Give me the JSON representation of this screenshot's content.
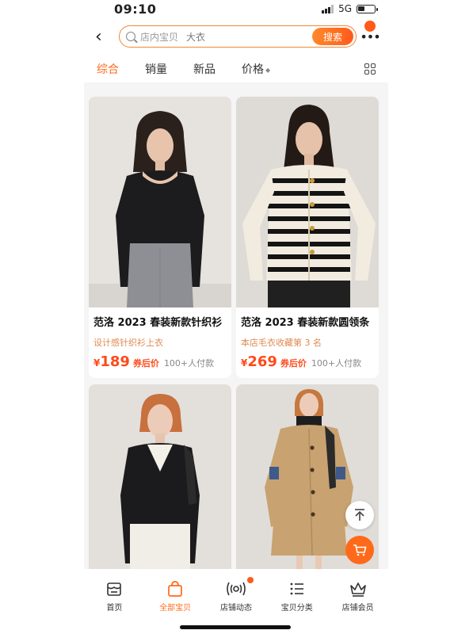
{
  "status": {
    "time": "09:10",
    "network": "5G"
  },
  "search": {
    "placeholder": "店内宝贝",
    "keyword": "大衣",
    "button": "搜索"
  },
  "sort": {
    "items": [
      "综合",
      "销量",
      "新品",
      "价格"
    ],
    "active_index": 0
  },
  "products": [
    {
      "title": "范洛 2023 春装新款针织衫",
      "subtitle": "设计感针织衫上衣",
      "currency": "¥",
      "price": "189",
      "coupon": "券后价",
      "paid": "100+人付款"
    },
    {
      "title": "范洛 2023 春装新款圆领条",
      "subtitle": "本店毛衣收藏第 3 名",
      "currency": "¥",
      "price": "269",
      "coupon": "券后价",
      "paid": "100+人付款"
    },
    {
      "title": "",
      "subtitle": "",
      "currency": "",
      "price": "",
      "coupon": "",
      "paid": ""
    },
    {
      "title": "",
      "subtitle": "",
      "currency": "",
      "price": "",
      "coupon": "",
      "paid": ""
    }
  ],
  "tabbar": {
    "items": [
      "首页",
      "全部宝贝",
      "店铺动态",
      "宝贝分类",
      "店铺会员"
    ],
    "active_index": 1
  },
  "colors": {
    "accent": "#ff6a1a",
    "price": "#ff4a1a",
    "subtitle": "#e08a50"
  },
  "icons": [
    "back-icon",
    "search-icon",
    "more-icon",
    "grid-view-icon",
    "back-to-top-icon",
    "cart-icon",
    "home-icon",
    "bag-icon",
    "broadcast-icon",
    "list-icon",
    "crown-icon"
  ]
}
